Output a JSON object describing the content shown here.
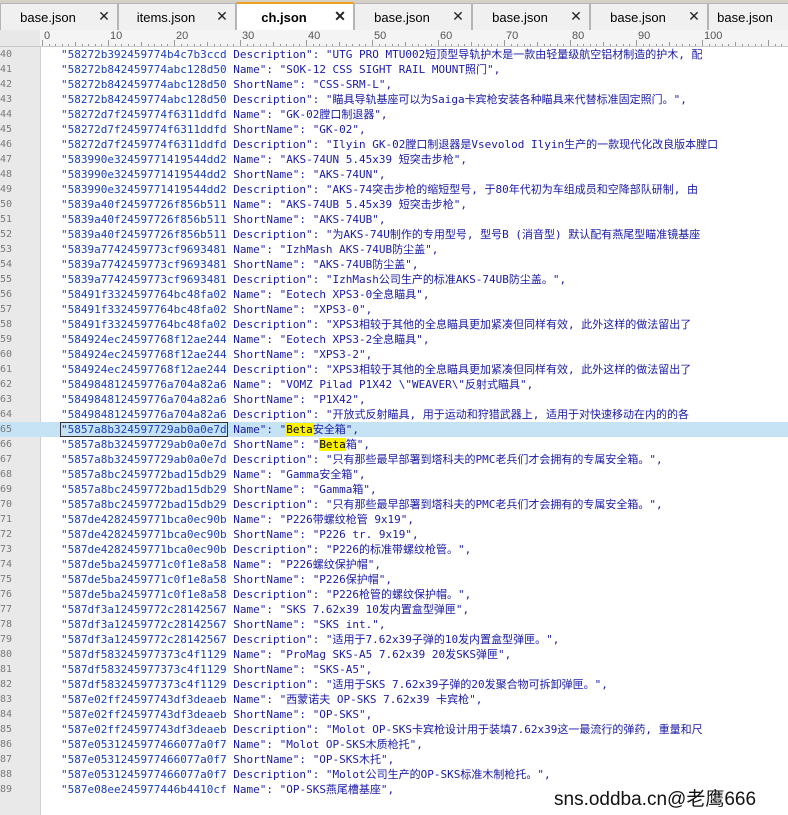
{
  "tabs": [
    {
      "label": "base.json",
      "active": false
    },
    {
      "label": "items.json",
      "active": false
    },
    {
      "label": "ch.json",
      "active": true
    },
    {
      "label": "base.json",
      "active": false
    },
    {
      "label": "base.json",
      "active": false
    },
    {
      "label": "base.json",
      "active": false
    },
    {
      "label": "base.json",
      "active": false
    }
  ],
  "ruler": {
    "numbers": [
      "0",
      "10",
      "20",
      "30",
      "40",
      "50",
      "60",
      "70",
      "80",
      "90",
      "100"
    ]
  },
  "editor": {
    "current_line": 65,
    "search_term": "Beta",
    "lines": [
      {
        "n": "40",
        "id": "\"58272b392459774b4c7b3ccd",
        "key": "Description\":",
        "val": "\"UTG PRO MTU002短顶型导轨护木是一款由轻量级航空铝材制造的护木, 配"
      },
      {
        "n": "41",
        "id": "\"58272b842459774abc128d50",
        "key": "Name\":",
        "val": "\"SOK-12 CSS SIGHT RAIL MOUNT照门\","
      },
      {
        "n": "42",
        "id": "\"58272b842459774abc128d50",
        "key": "ShortName\":",
        "val": "\"CSS-SRM-L\","
      },
      {
        "n": "43",
        "id": "\"58272b842459774abc128d50",
        "key": "Description\":",
        "val": "\"瞄具导轨基座可以为Saiga卡宾枪安装各种瞄具来代替标准固定照门。\","
      },
      {
        "n": "44",
        "id": "\"58272d7f2459774f6311ddfd",
        "key": "Name\":",
        "val": "\"GK-02膛口制退器\","
      },
      {
        "n": "45",
        "id": "\"58272d7f2459774f6311ddfd",
        "key": "ShortName\":",
        "val": "\"GK-02\","
      },
      {
        "n": "46",
        "id": "\"58272d7f2459774f6311ddfd",
        "key": "Description\":",
        "val": "\"Ilyin GK-02膛口制退器是Vsevolod Ilyin生产的一款现代化改良版本膛口"
      },
      {
        "n": "47",
        "id": "\"583990e32459771419544dd2",
        "key": "Name\":",
        "val": "\"AKS-74UN 5.45x39 短突击步枪\","
      },
      {
        "n": "48",
        "id": "\"583990e32459771419544dd2",
        "key": "ShortName\":",
        "val": "\"AKS-74UN\","
      },
      {
        "n": "49",
        "id": "\"583990e32459771419544dd2",
        "key": "Description\":",
        "val": "\"AKS-74突击步枪的缩短型号, 于80年代初为车组成员和空降部队研制, 由"
      },
      {
        "n": "50",
        "id": "\"5839a40f24597726f856b511",
        "key": "Name\":",
        "val": "\"AKS-74UB 5.45x39 短突击步枪\","
      },
      {
        "n": "51",
        "id": "\"5839a40f24597726f856b511",
        "key": "ShortName\":",
        "val": "\"AKS-74UB\","
      },
      {
        "n": "52",
        "id": "\"5839a40f24597726f856b511",
        "key": "Description\":",
        "val": "\"为AKS-74U制作的专用型号, 型号B (消音型) 默认配有燕尾型瞄准镜基座"
      },
      {
        "n": "53",
        "id": "\"5839a7742459773cf9693481",
        "key": "Name\":",
        "val": "\"IzhMash AKS-74UB防尘盖\","
      },
      {
        "n": "54",
        "id": "\"5839a7742459773cf9693481",
        "key": "ShortName\":",
        "val": "\"AKS-74UB防尘盖\","
      },
      {
        "n": "55",
        "id": "\"5839a7742459773cf9693481",
        "key": "Description\":",
        "val": "\"IzhMash公司生产的标准AKS-74UB防尘盖。\","
      },
      {
        "n": "56",
        "id": "\"58491f3324597764bc48fa02",
        "key": "Name\":",
        "val": "\"Eotech XPS3-0全息瞄具\","
      },
      {
        "n": "57",
        "id": "\"58491f3324597764bc48fa02",
        "key": "ShortName\":",
        "val": "\"XPS3-0\","
      },
      {
        "n": "58",
        "id": "\"58491f3324597764bc48fa02",
        "key": "Description\":",
        "val": "\"XPS3相较于其他的全息瞄具更加紧凑但同样有效, 此外这样的做法留出了"
      },
      {
        "n": "59",
        "id": "\"584924ec24597768f12ae244",
        "key": "Name\":",
        "val": "\"Eotech XPS3-2全息瞄具\","
      },
      {
        "n": "60",
        "id": "\"584924ec24597768f12ae244",
        "key": "ShortName\":",
        "val": "\"XPS3-2\","
      },
      {
        "n": "61",
        "id": "\"584924ec24597768f12ae244",
        "key": "Description\":",
        "val": "\"XPS3相较于其他的全息瞄具更加紧凑但同样有效, 此外这样的做法留出了"
      },
      {
        "n": "62",
        "id": "\"584984812459776a704a82a6",
        "key": "Name\":",
        "val": "\"VOMZ Pilad P1X42 \\\"WEAVER\\\"反射式瞄具\","
      },
      {
        "n": "63",
        "id": "\"584984812459776a704a82a6",
        "key": "ShortName\":",
        "val": "\"P1X42\","
      },
      {
        "n": "64",
        "id": "\"584984812459776a704a82a6",
        "key": "Description\":",
        "val": "\"开放式反射瞄具, 用于运动和狩猎武器上, 适用于对快速移动在内的的各"
      },
      {
        "n": "65",
        "id": "\"5857a8b324597729ab0a0e7d",
        "key": "Name\":",
        "val_pre": "\"",
        "val_hl": "Beta",
        "val_post": "安全箱\","
      },
      {
        "n": "66",
        "id": "\"5857a8b324597729ab0a0e7d",
        "key": "ShortName\":",
        "val_pre": "\"",
        "val_hl": "Beta",
        "val_post": "箱\","
      },
      {
        "n": "67",
        "id": "\"5857a8b324597729ab0a0e7d",
        "key": "Description\":",
        "val": "\"只有那些最早部署到塔科夫的PMC老兵们才会拥有的专属安全箱。\","
      },
      {
        "n": "68",
        "id": "\"5857a8bc2459772bad15db29",
        "key": "Name\":",
        "val": "\"Gamma安全箱\","
      },
      {
        "n": "69",
        "id": "\"5857a8bc2459772bad15db29",
        "key": "ShortName\":",
        "val": "\"Gamma箱\","
      },
      {
        "n": "70",
        "id": "\"5857a8bc2459772bad15db29",
        "key": "Description\":",
        "val": "\"只有那些最早部署到塔科夫的PMC老兵们才会拥有的专属安全箱。\","
      },
      {
        "n": "71",
        "id": "\"587de4282459771bca0ec90b",
        "key": "Name\":",
        "val": "\"P226带螺纹枪管 9x19\","
      },
      {
        "n": "72",
        "id": "\"587de4282459771bca0ec90b",
        "key": "ShortName\":",
        "val": "\"P226 tr. 9x19\","
      },
      {
        "n": "73",
        "id": "\"587de4282459771bca0ec90b",
        "key": "Description\":",
        "val": "\"P226的标准带螺纹枪管。\","
      },
      {
        "n": "74",
        "id": "\"587de5ba2459771c0f1e8a58",
        "key": "Name\":",
        "val": "\"P226螺纹保护帽\","
      },
      {
        "n": "75",
        "id": "\"587de5ba2459771c0f1e8a58",
        "key": "ShortName\":",
        "val": "\"P226保护帽\","
      },
      {
        "n": "76",
        "id": "\"587de5ba2459771c0f1e8a58",
        "key": "Description\":",
        "val": "\"P226枪管的螺纹保护帽。\","
      },
      {
        "n": "77",
        "id": "\"587df3a12459772c28142567",
        "key": "Name\":",
        "val": "\"SKS 7.62x39 10发内置盒型弹匣\","
      },
      {
        "n": "78",
        "id": "\"587df3a12459772c28142567",
        "key": "ShortName\":",
        "val": "\"SKS int.\","
      },
      {
        "n": "79",
        "id": "\"587df3a12459772c28142567",
        "key": "Description\":",
        "val": "\"适用于7.62x39子弹的10发内置盒型弹匣。\","
      },
      {
        "n": "80",
        "id": "\"587df583245977373c4f1129",
        "key": "Name\":",
        "val": "\"ProMag SKS-A5 7.62x39 20发SKS弹匣\","
      },
      {
        "n": "81",
        "id": "\"587df583245977373c4f1129",
        "key": "ShortName\":",
        "val": "\"SKS-A5\","
      },
      {
        "n": "82",
        "id": "\"587df583245977373c4f1129",
        "key": "Description\":",
        "val": "\"适用于SKS 7.62x39子弹的20发聚合物可拆卸弹匣。\","
      },
      {
        "n": "83",
        "id": "\"587e02ff24597743df3deaeb",
        "key": "Name\":",
        "val": "\"西蒙诺夫 OP-SKS 7.62x39 卡宾枪\","
      },
      {
        "n": "84",
        "id": "\"587e02ff24597743df3deaeb",
        "key": "ShortName\":",
        "val": "\"OP-SKS\","
      },
      {
        "n": "85",
        "id": "\"587e02ff24597743df3deaeb",
        "key": "Description\":",
        "val": "\"Molot OP-SKS卡宾枪设计用于装填7.62x39这一最流行的弹药, 重量和尺"
      },
      {
        "n": "86",
        "id": "\"587e0531245977466077a0f7",
        "key": "Name\":",
        "val": "\"Molot OP-SKS木质枪托\","
      },
      {
        "n": "87",
        "id": "\"587e0531245977466077a0f7",
        "key": "ShortName\":",
        "val": "\"OP-SKS木托\","
      },
      {
        "n": "88",
        "id": "\"587e0531245977466077a0f7",
        "key": "Description\":",
        "val": "\"Molot公司生产的OP-SKS标准木制枪托。\","
      },
      {
        "n": "89",
        "id": "\"587e08ee245977446b4410cf",
        "key": "Name\":",
        "val": "\"OP-SKS燕尾槽基座\","
      }
    ]
  },
  "watermark": "sns.oddba.cn@老鹰666"
}
